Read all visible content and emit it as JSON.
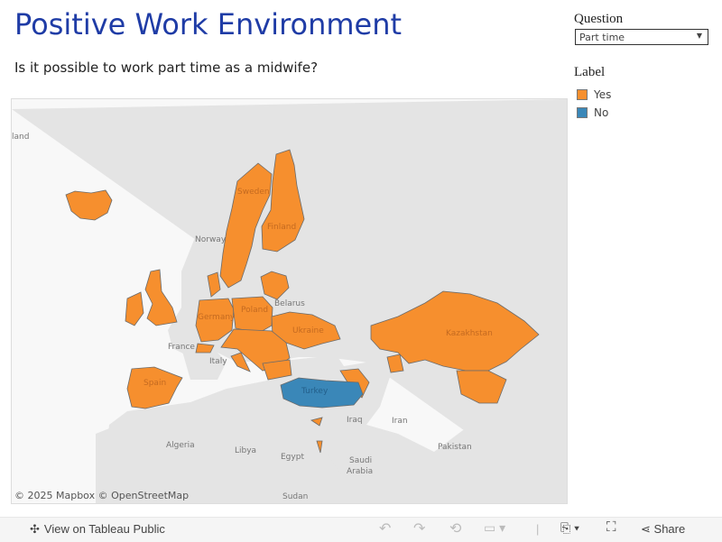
{
  "title": "Positive Work Environment",
  "subtitle": "Is it possible to work part time as a midwife?",
  "filter": {
    "title": "Question",
    "value": "Part time"
  },
  "legend": {
    "title": "Label",
    "items": [
      {
        "label": "Yes",
        "color": "#f68f2e"
      },
      {
        "label": "No",
        "color": "#3a87b8"
      }
    ]
  },
  "map": {
    "attribution": "© 2025 Mapbox  © OpenStreetMap",
    "labels": {
      "land": "land",
      "norway": "Norway",
      "sweden": "Sweden",
      "finland": "Finland",
      "belarus": "Belarus",
      "poland": "Poland",
      "germany": "Germany",
      "ukraine": "Ukraine",
      "france": "France",
      "italy": "Italy",
      "spain": "Spain",
      "turkey": "Turkey",
      "kazakhstan": "Kazakhstan",
      "iraq": "Iraq",
      "iran": "Iran",
      "algeria": "Algeria",
      "libya": "Libya",
      "egypt": "Egypt",
      "saudi": "Saudi",
      "arabia": "Arabia",
      "pakistan": "Pakistan",
      "sudan": "Sudan"
    },
    "yes_countries": [
      "Iceland",
      "Sweden",
      "Finland",
      "United Kingdom",
      "Ireland",
      "Denmark",
      "Germany",
      "Poland",
      "Baltics",
      "Ukraine",
      "Czechia",
      "Austria",
      "Hungary",
      "Romania",
      "Bulgaria",
      "Croatia",
      "Switzerland",
      "Spain",
      "Portugal",
      "Kazakhstan",
      "Central Asia",
      "Caucasus",
      "Cyprus",
      "Israel"
    ],
    "no_countries": [
      "Turkey"
    ]
  },
  "toolbar": {
    "view_label": "View on Tableau Public",
    "share_label": "Share"
  }
}
